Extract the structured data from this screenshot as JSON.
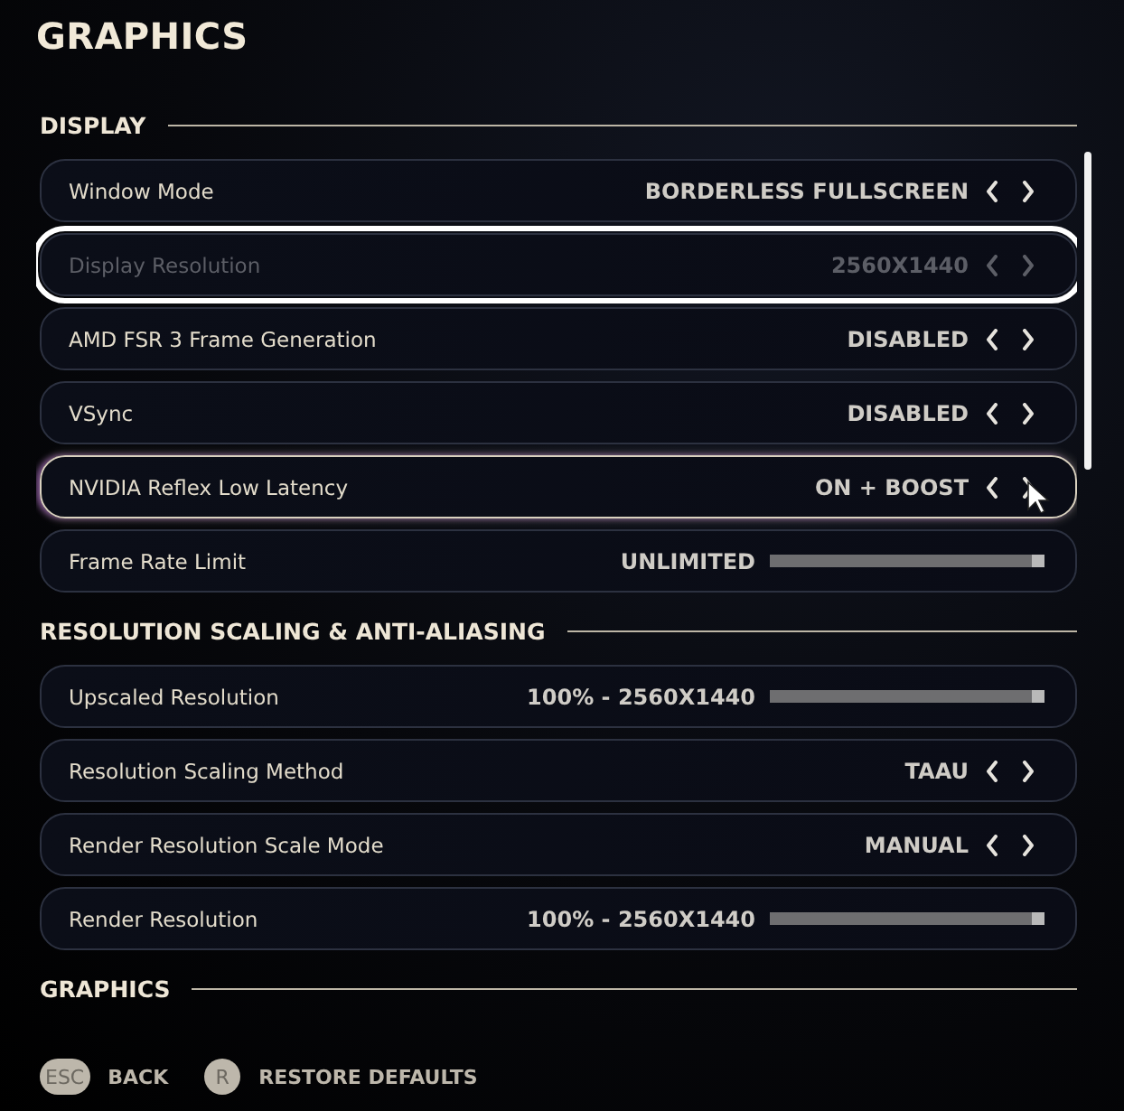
{
  "title": "GRAPHICS",
  "sections": [
    {
      "title": "DISPLAY",
      "rows": [
        {
          "kind": "choice",
          "label": "Window Mode",
          "value": "BORDERLESS FULLSCREEN",
          "disabled": false,
          "focused": false,
          "hovered": false
        },
        {
          "kind": "choice",
          "label": "Display Resolution",
          "value": "2560X1440",
          "disabled": true,
          "focused": true,
          "hovered": false
        },
        {
          "kind": "choice",
          "label": "AMD FSR 3 Frame Generation",
          "value": "DISABLED",
          "disabled": false,
          "focused": false,
          "hovered": false
        },
        {
          "kind": "choice",
          "label": "VSync",
          "value": "DISABLED",
          "disabled": false,
          "focused": false,
          "hovered": false
        },
        {
          "kind": "choice",
          "label": "NVIDIA Reflex Low Latency",
          "value": "ON + BOOST",
          "disabled": false,
          "focused": false,
          "hovered": true
        },
        {
          "kind": "slider",
          "label": "Frame Rate Limit",
          "value": "UNLIMITED",
          "level": 1,
          "disabled": false,
          "focused": false,
          "hovered": false
        }
      ]
    },
    {
      "title": "RESOLUTION SCALING & ANTI-ALIASING",
      "rows": [
        {
          "kind": "slider",
          "label": "Upscaled Resolution",
          "value": "100% - 2560X1440",
          "level": 1,
          "disabled": false,
          "focused": false,
          "hovered": false
        },
        {
          "kind": "choice",
          "label": "Resolution Scaling Method",
          "value": "TAAU",
          "disabled": false,
          "focused": false,
          "hovered": false
        },
        {
          "kind": "choice",
          "label": "Render Resolution Scale Mode",
          "value": "MANUAL",
          "disabled": false,
          "focused": false,
          "hovered": false
        },
        {
          "kind": "slider",
          "label": "Render Resolution",
          "value": "100% - 2560X1440",
          "level": 1,
          "disabled": false,
          "focused": false,
          "hovered": false
        }
      ]
    },
    {
      "title": "GRAPHICS"
    }
  ],
  "footer": [
    {
      "key": "ESC",
      "label": "BACK"
    },
    {
      "key": "R",
      "label": "RESTORE DEFAULTS"
    }
  ]
}
